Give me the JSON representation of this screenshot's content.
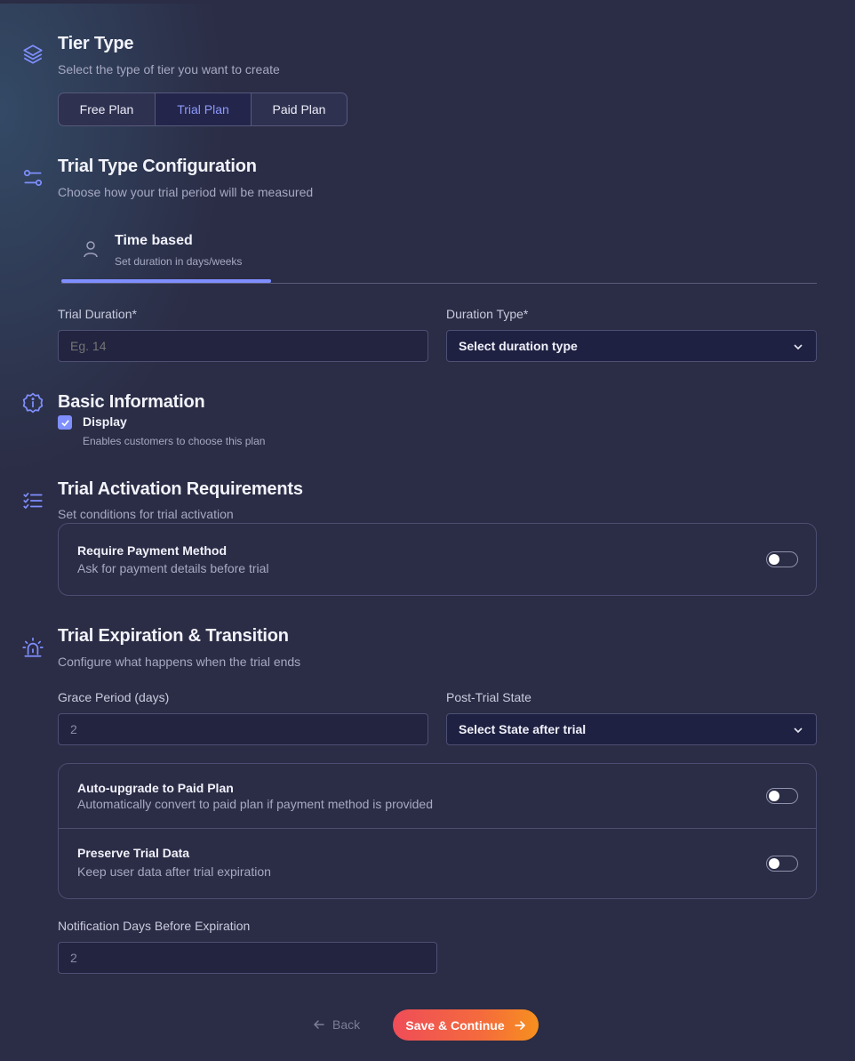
{
  "tier_type": {
    "title": "Tier Type",
    "subtitle": "Select the type of tier you want to create",
    "options": [
      "Free Plan",
      "Trial Plan",
      "Paid Plan"
    ],
    "selected": "Trial Plan"
  },
  "trial_type": {
    "title": "Trial Type Configuration",
    "subtitle": "Choose how your trial period will be measured",
    "tab_title": "Time based",
    "tab_sub": "Set duration in days/weeks",
    "duration_label": "Trial Duration*",
    "duration_placeholder": "Eg. 14",
    "duration_type_label": "Duration Type*",
    "duration_type_value": "Select duration type"
  },
  "basic_info": {
    "title": "Basic Information",
    "display_label": "Display",
    "display_sub": "Enables customers to choose this plan",
    "display_checked": true
  },
  "activation": {
    "title": "Trial Activation Requirements",
    "subtitle": "Set conditions for trial activation",
    "require_payment_title": "Require Payment Method",
    "require_payment_sub": "Ask for payment details before trial",
    "require_payment_on": false
  },
  "expiration": {
    "title": "Trial Expiration & Transition",
    "subtitle": "Configure what happens when the trial ends",
    "grace_label": "Grace Period (days)",
    "grace_value": "2",
    "post_state_label": "Post-Trial State",
    "post_state_value": "Select State after trial",
    "auto_upgrade_title": "Auto-upgrade to Paid Plan",
    "auto_upgrade_sub": "Automatically convert to paid plan if payment method is provided",
    "auto_upgrade_on": false,
    "preserve_title": "Preserve Trial Data",
    "preserve_sub": "Keep user data after trial expiration",
    "preserve_on": false,
    "notify_label": "Notification Days Before Expiration",
    "notify_value": "2"
  },
  "actions": {
    "back": "Back",
    "save": "Save & Continue"
  },
  "colors": {
    "background": "#2b2c45",
    "accent": "#7f8fff",
    "save_gradient_start": "#ef4d58",
    "save_gradient_end": "#f7901e"
  }
}
